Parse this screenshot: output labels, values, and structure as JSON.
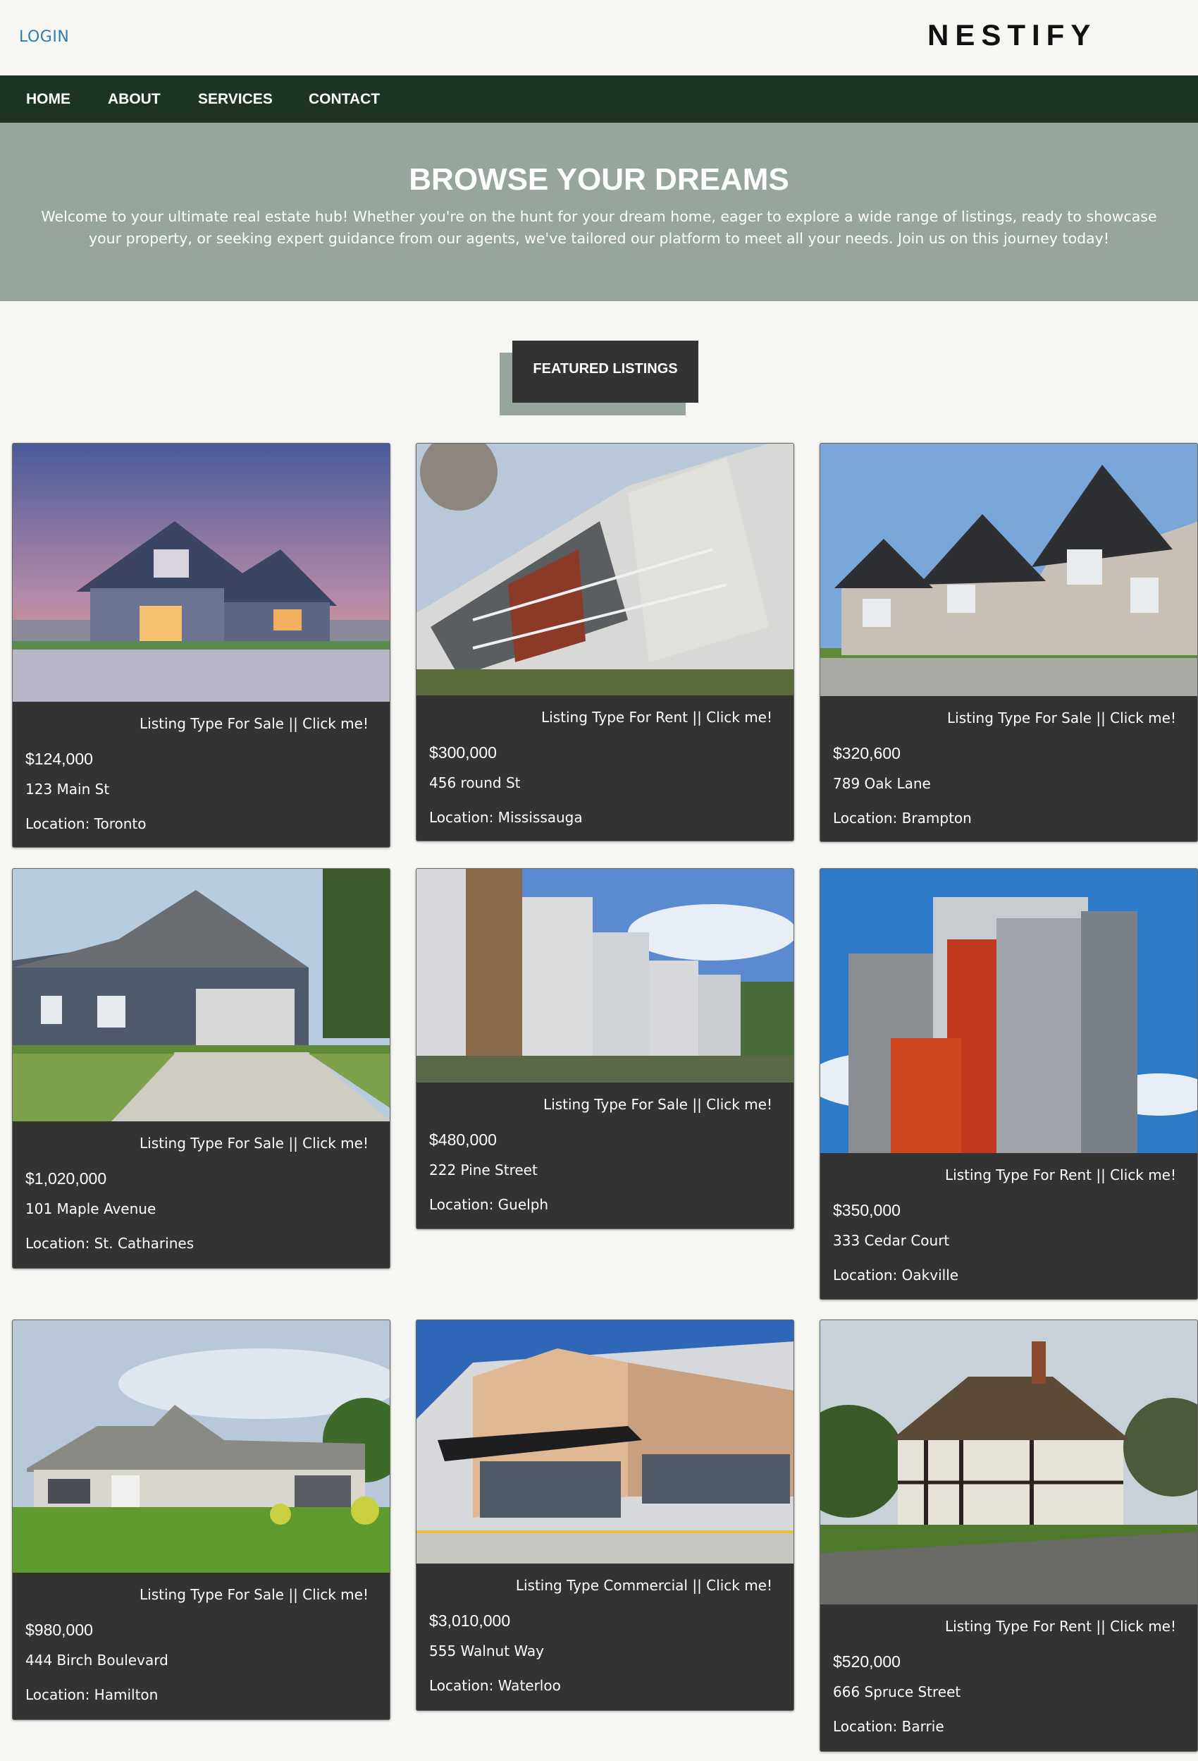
{
  "header": {
    "login": "LOGIN",
    "brand": "NESTIFY"
  },
  "nav": {
    "items": [
      "HOME",
      "ABOUT",
      "SERVICES",
      "CONTACT"
    ]
  },
  "hero": {
    "title": "BROWSE YOUR DREAMS",
    "text": "Welcome to your ultimate real estate hub! Whether you're on the hunt for your dream home, eager to explore a wide range of listings, ready to showcase your property, or seeking expert guidance from our agents, we've tailored our platform to meet all your needs. Join us on this journey today!"
  },
  "featured": {
    "label": "FEATURED LISTINGS"
  },
  "listings": [
    {
      "type": "Listing Type For Sale || Click me!",
      "price": "$124,000",
      "address": "123 Main St",
      "location": "Location: Toronto",
      "image": "suburban-house-at-dusk"
    },
    {
      "type": "Listing Type For Rent || Click me!",
      "price": "$300,000",
      "address": "456 round St",
      "location": "Location: Mississauga",
      "image": "modern-apartment-building"
    },
    {
      "type": "Listing Type For Sale || Click me!",
      "price": "$320,600",
      "address": "789 Oak Lane",
      "location": "Location: Brampton",
      "image": "row-townhouses"
    },
    {
      "type": "Listing Type For Sale || Click me!",
      "price": "$1,020,000",
      "address": "101 Maple Avenue",
      "location": "Location: St. Catharines",
      "image": "house-with-garage-driveway"
    },
    {
      "type": "Listing Type For Sale || Click me!",
      "price": "$480,000",
      "address": "222 Pine Street",
      "location": "Location: Guelph",
      "image": "condo-buildings-row"
    },
    {
      "type": "Listing Type For Rent || Click me!",
      "price": "$350,000",
      "address": "333 Cedar Court",
      "location": "Location: Oakville",
      "image": "highrise-apartment-towers"
    },
    {
      "type": "Listing Type For Sale || Click me!",
      "price": "$980,000",
      "address": "444 Birch Boulevard",
      "location": "Location: Hamilton",
      "image": "ranch-house-with-lawn"
    },
    {
      "type": "Listing Type Commercial || Click me!",
      "price": "$3,010,000",
      "address": "555 Walnut Way",
      "location": "Location: Waterloo",
      "image": "commercial-storefront"
    },
    {
      "type": "Listing Type For Rent || Click me!",
      "price": "$520,000",
      "address": "666 Spruce Street",
      "location": "Location: Barrie",
      "image": "thatched-cottage"
    }
  ],
  "colors": {
    "nav": "#1d3324",
    "hero": "#98a59c",
    "card": "#333333",
    "login": "#2d7db3",
    "background": "#f6f6f3"
  }
}
